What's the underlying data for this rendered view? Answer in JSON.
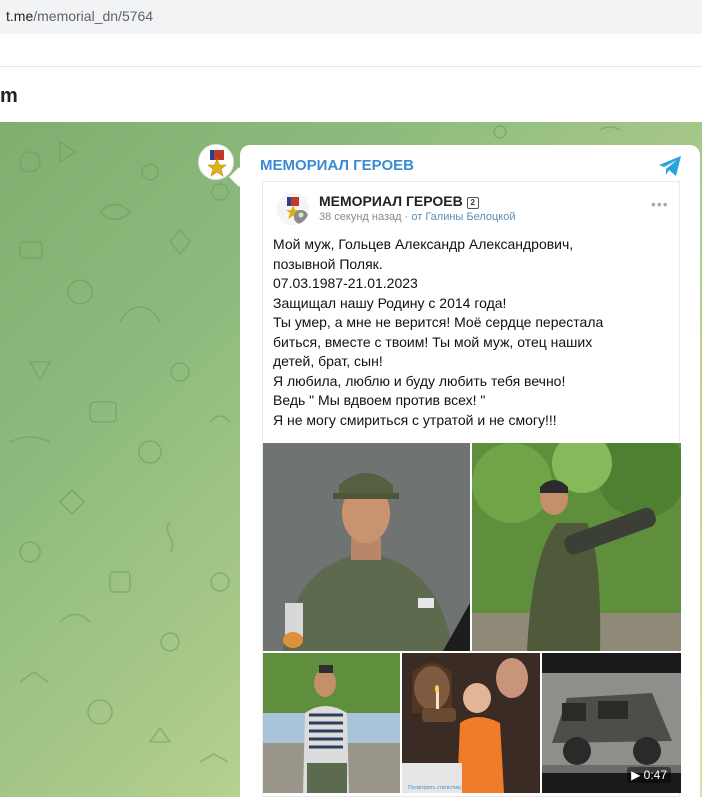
{
  "browser": {
    "url_host": "t.me",
    "url_path": "/memorial_dn/5764"
  },
  "site": {
    "logo_fragment": "m"
  },
  "channel": {
    "name": "МЕМОРИАЛ ГЕРОЕВ"
  },
  "post": {
    "author": "МЕМОРИАЛ ГЕРОЕВ",
    "badge": "2",
    "time": "38 секунд назад",
    "from_prefix": "·",
    "from_text": "от Галины Белоцкой",
    "lines": [
      "Мой муж, Гольцев Александр Александрович,",
      "позывной Поляк.",
      "07.03.1987-21.01.2023",
      "Защищал нашу Родину с 2014 года!",
      "Ты умер, а мне не верится! Моё сердце перестала",
      "биться, вместе с твоим! Ты мой муж, отец наших",
      "детей, брат, сын!",
      "Я любила, люблю и буду любить тебя вечно!",
      "Ведь \" Мы вдвоем против всех! \"",
      "Я не могу смириться с утратой и не смогу!!!"
    ]
  },
  "media": {
    "video_duration": "0:47",
    "stats_link": "Посмотреть статистику"
  },
  "colors": {
    "channel_link": "#3a8bd3",
    "telegram": "#2aa3df"
  }
}
